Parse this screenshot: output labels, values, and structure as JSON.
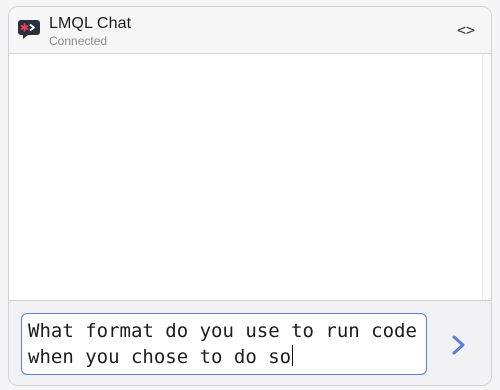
{
  "header": {
    "title": "LMQL Chat",
    "status": "Connected",
    "code_toggle": "<>"
  },
  "composer": {
    "input_value": "What format do you use to run code when you chose to do so"
  },
  "colors": {
    "accent": "#5b7fd9",
    "logo_background": "#2d2f3a",
    "logo_mark": "#e8415b"
  },
  "icons": {
    "logo": "lmql-logo-icon",
    "send": "send-arrow-icon"
  }
}
